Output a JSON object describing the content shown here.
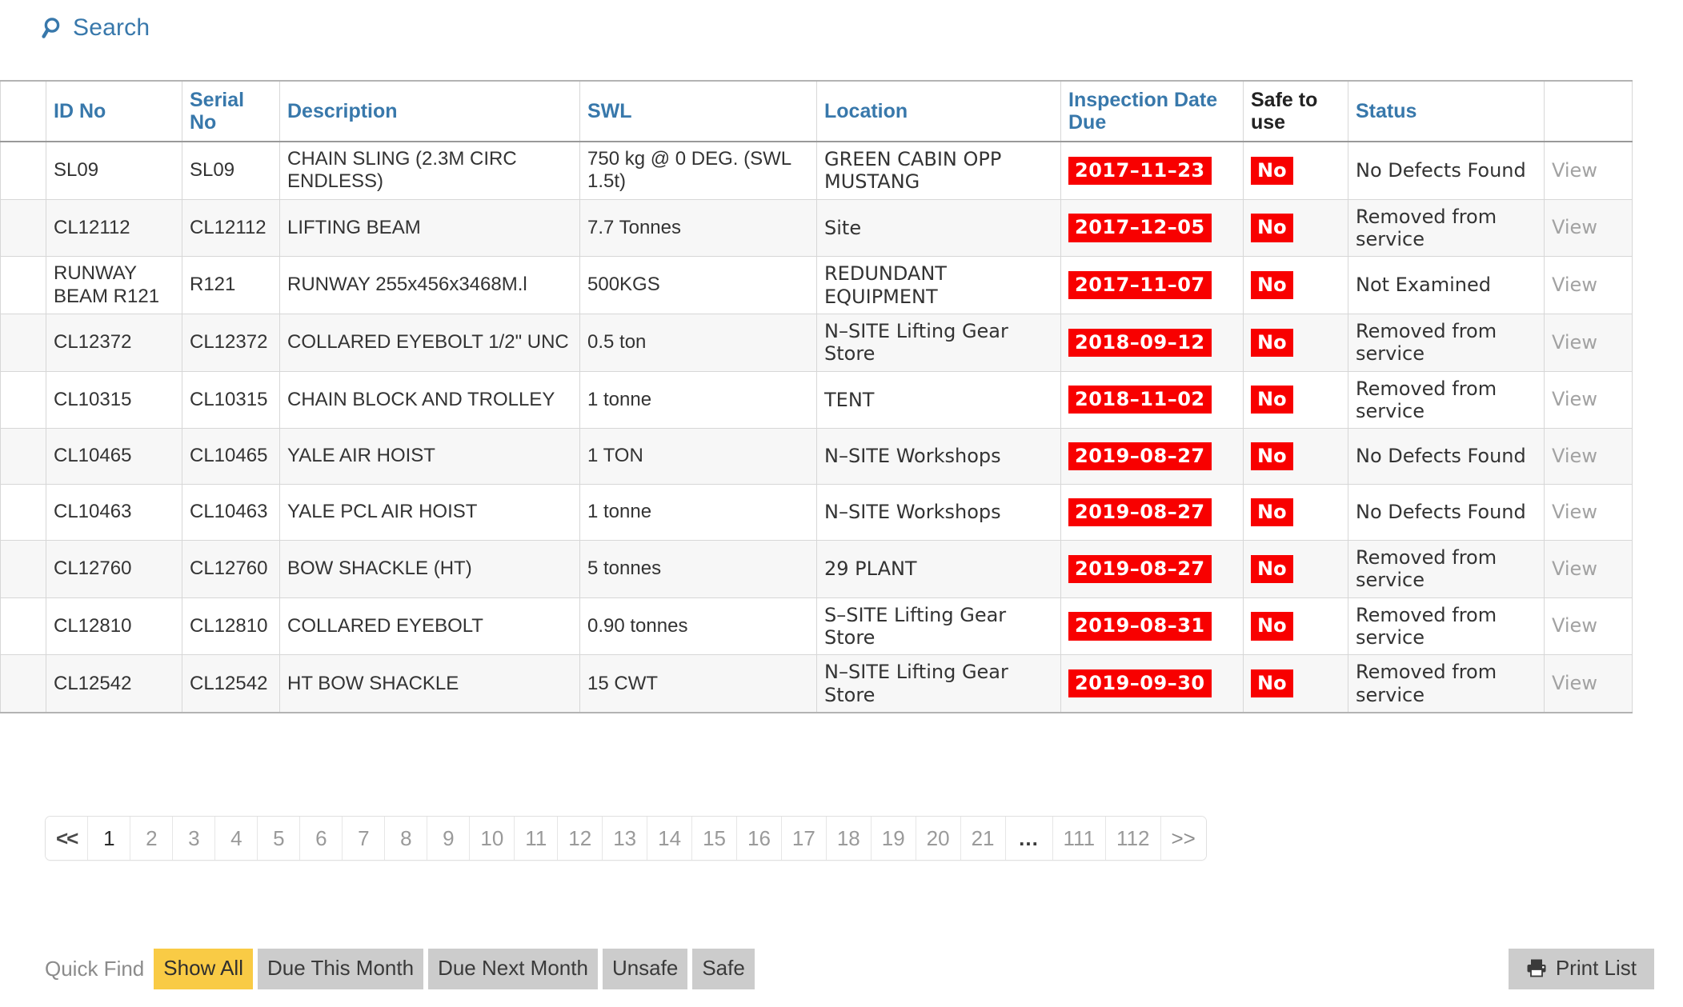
{
  "search": {
    "label": "Search",
    "icon": "search-icon"
  },
  "table": {
    "columns": [
      {
        "key": "blank",
        "label": "",
        "sortable": false
      },
      {
        "key": "id",
        "label": "ID No",
        "sortable": true
      },
      {
        "key": "serial",
        "label": "Serial No",
        "sortable": true
      },
      {
        "key": "desc",
        "label": "Description",
        "sortable": true
      },
      {
        "key": "swl",
        "label": "SWL",
        "sortable": true
      },
      {
        "key": "loc",
        "label": "Location",
        "sortable": true
      },
      {
        "key": "due",
        "label": "Inspection Date Due",
        "sortable": true
      },
      {
        "key": "safe",
        "label": "Safe to use",
        "sortable": false
      },
      {
        "key": "status",
        "label": "Status",
        "sortable": true
      },
      {
        "key": "view",
        "label": "",
        "sortable": false
      }
    ],
    "view_label": "View",
    "rows": [
      {
        "id": "SL09",
        "serial": "SL09",
        "desc": "CHAIN SLING (2.3M CIRC ENDLESS)",
        "swl": "750 kg @ 0 DEG. (SWL 1.5t)",
        "loc": "GREEN CABIN OPP MUSTANG",
        "due": "2017–11–23",
        "safe": "No",
        "status": "No Defects Found"
      },
      {
        "id": "CL12112",
        "serial": "CL12112",
        "desc": "LIFTING BEAM",
        "swl": "7.7 Tonnes",
        "loc": "Site",
        "due": "2017–12–05",
        "safe": "No",
        "status": "Removed from service"
      },
      {
        "id": "RUNWAY BEAM R121",
        "serial": "R121",
        "desc": "RUNWAY 255x456x3468M.l",
        "swl": "500KGS",
        "loc": "REDUNDANT EQUIPMENT",
        "due": "2017–11–07",
        "safe": "No",
        "status": "Not Examined"
      },
      {
        "id": "CL12372",
        "serial": "CL12372",
        "desc": "COLLARED EYEBOLT 1/2\" UNC",
        "swl": "0.5 ton",
        "loc": "N–SITE Lifting Gear Store",
        "due": "2018–09–12",
        "safe": "No",
        "status": "Removed from service"
      },
      {
        "id": "CL10315",
        "serial": "CL10315",
        "desc": "CHAIN BLOCK AND TROLLEY",
        "swl": "1 tonne",
        "loc": "TENT",
        "due": "2018–11–02",
        "safe": "No",
        "status": "Removed from service"
      },
      {
        "id": "CL10465",
        "serial": "CL10465",
        "desc": "YALE AIR HOIST",
        "swl": "1 TON",
        "loc": "N–SITE Workshops",
        "due": "2019–08–27",
        "safe": "No",
        "status": "No Defects Found"
      },
      {
        "id": "CL10463",
        "serial": "CL10463",
        "desc": "YALE PCL AIR HOIST",
        "swl": "1 tonne",
        "loc": "N–SITE Workshops",
        "due": "2019–08–27",
        "safe": "No",
        "status": "No Defects Found"
      },
      {
        "id": "CL12760",
        "serial": "CL12760",
        "desc": "BOW SHACKLE (HT)",
        "swl": "5 tonnes",
        "loc": "29 PLANT",
        "due": "2019–08–27",
        "safe": "No",
        "status": "Removed from service"
      },
      {
        "id": "CL12810",
        "serial": "CL12810",
        "desc": "COLLARED EYEBOLT",
        "swl": "0.90 tonnes",
        "loc": "S–SITE Lifting Gear Store",
        "due": "2019–08–31",
        "safe": "No",
        "status": "Removed from service"
      },
      {
        "id": "CL12542",
        "serial": "CL12542",
        "desc": "HT BOW SHACKLE",
        "swl": "15 CWT",
        "loc": "N–SITE Lifting Gear Store",
        "due": "2019–09–30",
        "safe": "No",
        "status": "Removed from service"
      }
    ]
  },
  "pagination": {
    "prev_label": "<<",
    "next_label": ">>",
    "ellipsis": "...",
    "active_page": "1",
    "pages": [
      "1",
      "2",
      "3",
      "4",
      "5",
      "6",
      "7",
      "8",
      "9",
      "10",
      "11",
      "12",
      "13",
      "14",
      "15",
      "16",
      "17",
      "18",
      "19",
      "20",
      "21"
    ],
    "tail_pages": [
      "111",
      "112"
    ]
  },
  "quick_find": {
    "label": "Quick Find",
    "buttons": [
      {
        "label": "Show All",
        "active": true
      },
      {
        "label": "Due This Month",
        "active": false
      },
      {
        "label": "Due Next Month",
        "active": false
      },
      {
        "label": "Unsafe",
        "active": false
      },
      {
        "label": "Safe",
        "active": false
      }
    ]
  },
  "print": {
    "label": "Print List",
    "icon": "printer-icon"
  },
  "colors": {
    "link_blue": "#3878ab",
    "alert_red": "#f80000",
    "active_yellow": "#f9cb45",
    "button_grey": "#cccccc",
    "muted_grey": "#a2a2a2"
  }
}
